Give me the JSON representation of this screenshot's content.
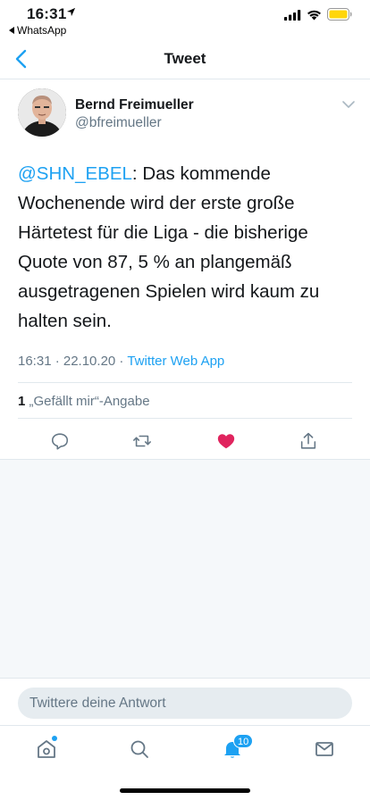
{
  "status_bar": {
    "time": "16:31",
    "back_app": "WhatsApp"
  },
  "nav": {
    "title": "Tweet"
  },
  "tweet": {
    "author_name": "Bernd Freimueller",
    "author_handle": "@bfreimueller",
    "mention": "@SHN_EBEL",
    "body": ": Das kommende Wochenende wird der erste große Härtetest für die Liga - die bisherige Quote von 87, 5 % an plangemäß ausgetragenen Spielen wird kaum zu halten sein.",
    "time": "16:31 · 22.10.20 · ",
    "source": "Twitter Web App",
    "like_count": "1",
    "like_label": " „Gefällt mir“-Angabe",
    "liked": true,
    "accent_color": "#1da1f2",
    "like_color": "#e0245e"
  },
  "reply": {
    "placeholder": "Twittere deine Antwort"
  },
  "tabbar": {
    "notifications_badge": "10"
  }
}
